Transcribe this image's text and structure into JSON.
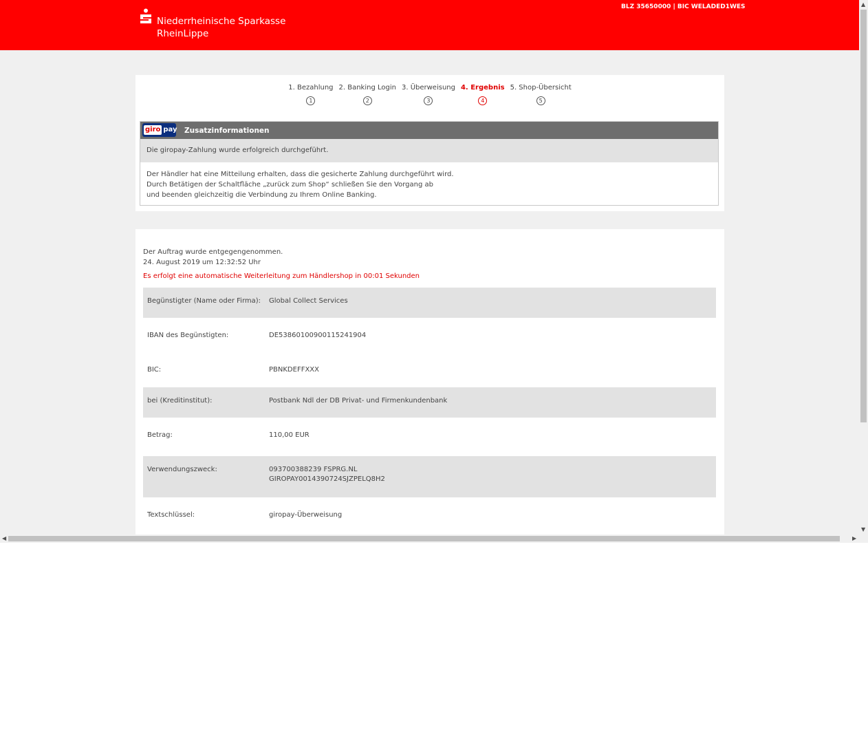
{
  "header": {
    "bank_name_line1": "Niederrheinische Sparkasse",
    "bank_name_line2": "RheinLippe",
    "blz_bic": "BLZ 35650000 | BIC WELADED1WES",
    "brand_color": "#ff0000"
  },
  "steps": [
    {
      "label": "1. Bezahlung",
      "num": "1",
      "active": false
    },
    {
      "label": "2. Banking Login",
      "num": "2",
      "active": false
    },
    {
      "label": "3. Überweisung",
      "num": "3",
      "active": false
    },
    {
      "label": "4. Ergebnis",
      "num": "4",
      "active": true
    },
    {
      "label": "5. Shop-Übersicht",
      "num": "5",
      "active": false
    }
  ],
  "infobox": {
    "logo_giro": "giro",
    "logo_pay": "pay",
    "title": "Zusatzinformationen",
    "success": "Die giropay-Zahlung wurde erfolgreich durchgeführt.",
    "body_line1": "Der Händler hat eine Mitteilung erhalten, dass die gesicherte Zahlung durchgeführt wird.",
    "body_line2": "Durch Betätigen der Schaltfläche „zurück zum Shop“ schließen Sie den Vorgang ab",
    "body_line3": "und beenden gleichzeitig die Verbindung zu Ihrem Online Banking."
  },
  "confirmation": {
    "line1": "Der Auftrag wurde entgegengenommen.",
    "line2": "24. August 2019 um 12:32:52 Uhr",
    "redirect": "Es erfolgt eine automatische Weiterleitung zum Händlershop in 00:01 Sekunden"
  },
  "details": [
    {
      "label": "Begünstigter (Name oder Firma):",
      "value": "Global Collect Services",
      "value2": ""
    },
    {
      "label": "IBAN des Begünstigten:",
      "value": "DE53860100900115241904",
      "value2": ""
    },
    {
      "label": "BIC:",
      "value": "PBNKDEFFXXX",
      "value2": ""
    },
    {
      "label": "bei (Kreditinstitut):",
      "value": "Postbank Ndl der DB Privat- und Firmenkundenbank",
      "value2": ""
    },
    {
      "label": "Betrag:",
      "value": "110,00 EUR",
      "value2": ""
    },
    {
      "label": "Verwendungszweck:",
      "value": "093700388239 FSPRG.NL",
      "value2": "GIROPAY0014390724SJZPELQ8H2"
    },
    {
      "label": "Textschlüssel:",
      "value": "giropay-Überweisung",
      "value2": ""
    }
  ]
}
